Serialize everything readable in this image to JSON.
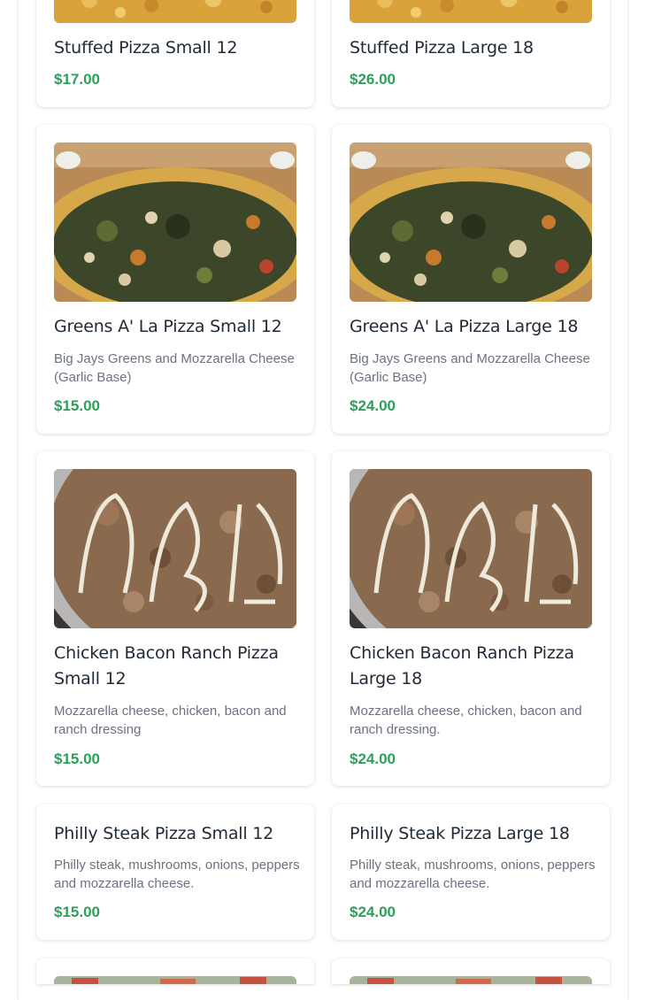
{
  "menu": {
    "items": [
      {
        "name": "Stuffed Pizza Small 12",
        "description": "",
        "price": "$17.00",
        "image": "cheese-pizza"
      },
      {
        "name": "Stuffed Pizza Large 18",
        "description": "",
        "price": "$26.00",
        "image": "cheese-pizza"
      },
      {
        "name": "Greens A' La Pizza Small 12",
        "description": "Big Jays Greens and Mozzarella Cheese (Garlic Base)",
        "price": "$15.00",
        "image": "greens-pizza"
      },
      {
        "name": "Greens A' La Pizza Large 18",
        "description": "Big Jays Greens and Mozzarella Cheese (Garlic Base)",
        "price": "$24.00",
        "image": "greens-pizza"
      },
      {
        "name": "Chicken Bacon Ranch Pizza Small 12",
        "description": "Mozzarella cheese, chicken, bacon and ranch dressing",
        "price": "$15.00",
        "image": "chicken-bacon-ranch-pizza"
      },
      {
        "name": "Chicken Bacon Ranch Pizza Large 18",
        "description": "Mozzarella cheese, chicken, bacon and ranch dressing.",
        "price": "$24.00",
        "image": "chicken-bacon-ranch-pizza"
      },
      {
        "name": "Philly Steak Pizza Small 12",
        "description": "Philly steak, mushrooms, onions, peppers and mozzarella cheese.",
        "price": "$15.00",
        "image": ""
      },
      {
        "name": "Philly Steak Pizza Large 18",
        "description": "Philly steak, mushrooms, onions, peppers and mozzarella cheese.",
        "price": "$24.00",
        "image": ""
      },
      {
        "name": "",
        "description": "",
        "price": "",
        "image": "veggie-pizza"
      },
      {
        "name": "",
        "description": "",
        "price": "",
        "image": "veggie-pizza"
      }
    ]
  },
  "colors": {
    "price": "#2e9e5b",
    "title": "#1f2a37",
    "description": "#6b7280"
  }
}
